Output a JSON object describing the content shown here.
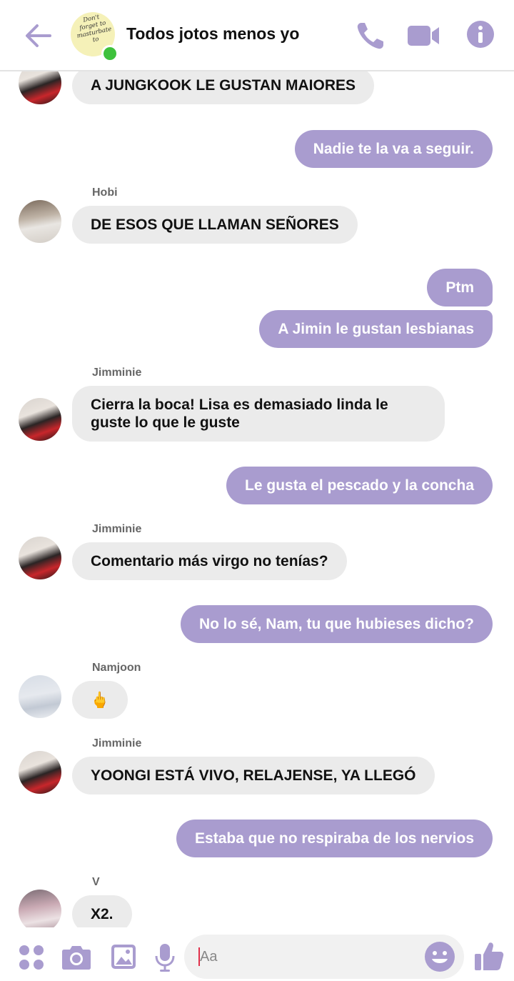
{
  "header": {
    "title": "Todos jotos menos yo",
    "avatar_text": "Don't forget to masturbate to",
    "online": true
  },
  "colors": {
    "accent": "#a99ccf",
    "incoming_bubble": "#ebebeb",
    "online": "#3ec13c"
  },
  "messages": [
    {
      "type": "in",
      "text": "A JUNGKOOK LE GUSTAN MAIORES"
    },
    {
      "type": "out",
      "text": "Nadie te la va a seguir."
    },
    {
      "type": "in",
      "sender": "Hobi",
      "text": "DE ESOS QUE LLAMAN SEÑORES"
    },
    {
      "type": "out",
      "text": "Ptm"
    },
    {
      "type": "out",
      "text": "A Jimin le gustan lesbianas"
    },
    {
      "type": "in",
      "sender": "Jimminie",
      "text": "Cierra la boca! Lisa es demasiado linda le guste lo que le guste"
    },
    {
      "type": "out",
      "text": "Le gusta el pescado y la concha"
    },
    {
      "type": "in",
      "sender": "Jimminie",
      "text": "Comentario más virgo no tenías?"
    },
    {
      "type": "out",
      "text": "No lo sé, Nam, tu que hubieses dicho?"
    },
    {
      "type": "in",
      "sender": "Namjoon",
      "text": "🖕"
    },
    {
      "type": "in",
      "sender": "Jimminie",
      "text": "YOONGI ESTÁ VIVO, RELAJENSE, YA LLEGÓ"
    },
    {
      "type": "out",
      "text": "Estaba que no respiraba de los nervios"
    },
    {
      "type": "in",
      "sender": "V",
      "text": "X2."
    }
  ],
  "composer": {
    "placeholder": "Aa",
    "icons": [
      "apps-icon",
      "camera-icon",
      "gallery-icon",
      "microphone-icon",
      "emoji-icon",
      "thumbs-up-icon"
    ]
  }
}
